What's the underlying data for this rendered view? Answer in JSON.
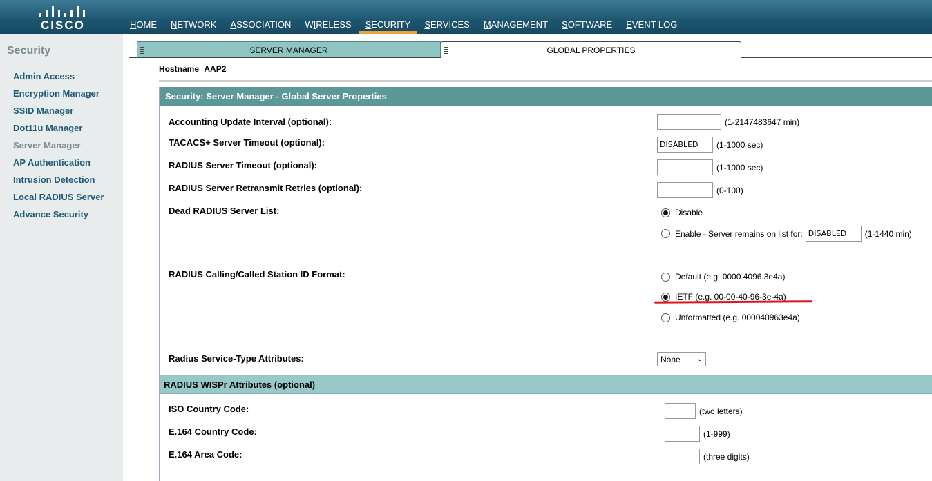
{
  "brand": {
    "logo_text": "CISCO"
  },
  "nav": {
    "items": [
      {
        "ul": "H",
        "rest": "OME"
      },
      {
        "ul": "N",
        "rest": "ETWORK"
      },
      {
        "ul": "A",
        "rest": "SSOCIATION"
      },
      {
        "pre": "W",
        "ul": "I",
        "rest": "RELESS"
      },
      {
        "ul": "S",
        "rest": "ECURITY"
      },
      {
        "ul": "S",
        "rest": "ERVICES"
      },
      {
        "ul": "M",
        "rest": "ANAGEMENT"
      },
      {
        "ul": "S",
        "rest": "OFTWARE"
      },
      {
        "ul": "E",
        "rest": "VENT LOG"
      }
    ],
    "active": "SECURITY"
  },
  "sidebar": {
    "title": "Security",
    "items": [
      {
        "label": "Admin Access"
      },
      {
        "label": "Encryption Manager"
      },
      {
        "label": "SSID Manager"
      },
      {
        "label": "Dot11u Manager"
      },
      {
        "label": "Server Manager"
      },
      {
        "label": "AP Authentication"
      },
      {
        "label": "Intrusion Detection"
      },
      {
        "label": "Local RADIUS Server"
      },
      {
        "label": "Advance Security"
      }
    ],
    "current": "Server Manager"
  },
  "tabs": {
    "server_manager": "SERVER MANAGER",
    "global_properties": "GLOBAL PROPERTIES",
    "active": "GLOBAL PROPERTIES"
  },
  "hostname": {
    "label": "Hostname",
    "value": "AAP2"
  },
  "section": {
    "title": "Security: Server Manager - Global Server Properties",
    "fields": {
      "accounting": {
        "label": "Accounting Update Interval (optional):",
        "value": "",
        "hint": "(1-2147483647 min)"
      },
      "tacacs": {
        "label": "TACACS+ Server Timeout (optional):",
        "value": "DISABLED",
        "hint": "(1-1000 sec)"
      },
      "radius_timeout": {
        "label": "RADIUS Server Timeout (optional):",
        "value": "",
        "hint": "(1-1000 sec)"
      },
      "radius_retries": {
        "label": "RADIUS Server Retransmit Retries (optional):",
        "value": "",
        "hint": "(0-100)"
      },
      "dead_list": {
        "label": "Dead RADIUS Server List:",
        "disable": "Disable",
        "enable": "Enable - Server remains on list for:",
        "enable_value": "DISABLED",
        "enable_hint": "(1-1440 min)",
        "selected": "Disable"
      },
      "station_id": {
        "label": "RADIUS Calling/Called Station ID Format:",
        "options": [
          "Default (e.g. 0000.4096.3e4a)",
          "IETF (e.g. 00-00-40-96-3e-4a)",
          "Unformatted (e.g. 000040963e4a)"
        ],
        "selected": "IETF (e.g. 00-00-40-96-3e-4a)"
      },
      "service_type": {
        "label": "Radius Service-Type Attributes:",
        "value": "None"
      }
    }
  },
  "wispr": {
    "title": "RADIUS WISPr Attributes (optional)",
    "iso": {
      "label": "ISO Country Code:",
      "value": "",
      "hint": "(two letters)"
    },
    "e164_country": {
      "label": "E.164 Country Code:",
      "value": "",
      "hint": "(1-999)"
    },
    "e164_area": {
      "label": "E.164 Area Code:",
      "value": "",
      "hint": "(three digits)"
    }
  },
  "colors": {
    "nav_bg": "#1d5570",
    "nav_active": "#e8a33a",
    "sidebar_link": "#1f5b78",
    "section_header": "#5b9897",
    "wispr_header": "#98c9c8",
    "annotation": "#e0141e"
  }
}
